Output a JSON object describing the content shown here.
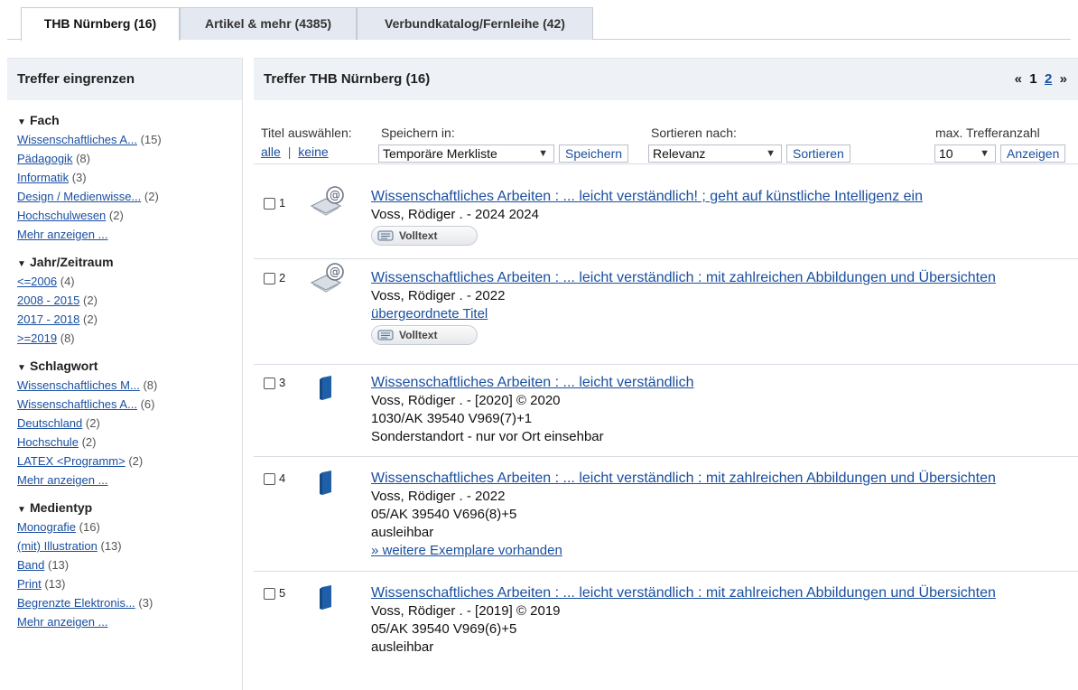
{
  "tabs": [
    {
      "label": "THB Nürnberg (16)",
      "active": true
    },
    {
      "label": "Artikel & mehr (4385)",
      "active": false
    },
    {
      "label": "Verbundkatalog/Fernleihe (42)",
      "active": false
    }
  ],
  "sidebar": {
    "title": "Treffer eingrenzen",
    "facets": [
      {
        "title": "Fach",
        "items": [
          {
            "label": "Wissenschaftliches A...",
            "count": "(15)"
          },
          {
            "label": "Pädagogik",
            "count": "(8)"
          },
          {
            "label": "Informatik",
            "count": "(3)"
          },
          {
            "label": "Design / Medienwisse...",
            "count": "(2)"
          },
          {
            "label": "Hochschulwesen",
            "count": "(2)"
          }
        ],
        "more": "Mehr anzeigen ..."
      },
      {
        "title": "Jahr/Zeitraum",
        "items": [
          {
            "label": "<=2006",
            "count": "(4)"
          },
          {
            "label": "2008 - 2015",
            "count": "(2)"
          },
          {
            "label": "2017 - 2018",
            "count": "(2)"
          },
          {
            "label": ">=2019",
            "count": "(8)"
          }
        ]
      },
      {
        "title": "Schlagwort",
        "items": [
          {
            "label": "Wissenschaftliches M...",
            "count": "(8)"
          },
          {
            "label": "Wissenschaftliches A...",
            "count": "(6)"
          },
          {
            "label": "Deutschland",
            "count": "(2)"
          },
          {
            "label": "Hochschule",
            "count": "(2)"
          },
          {
            "label": "LATEX <Programm>",
            "count": "(2)"
          }
        ],
        "more": "Mehr anzeigen ..."
      },
      {
        "title": "Medientyp",
        "items": [
          {
            "label": "Monografie",
            "count": "(16)"
          },
          {
            "label": "(mit) Illustration",
            "count": "(13)"
          },
          {
            "label": "Band",
            "count": "(13)"
          },
          {
            "label": "Print",
            "count": "(13)"
          },
          {
            "label": "Begrenzte Elektronis...",
            "count": "(3)"
          }
        ],
        "more": "Mehr anzeigen ..."
      }
    ]
  },
  "results_header": {
    "title": "Treffer THB Nürnberg (16)",
    "pager": {
      "prev": "«",
      "page1": "1",
      "page2": "2",
      "next": "»"
    }
  },
  "controls": {
    "select_title_label": "Titel auswählen:",
    "all": "alle",
    "separator": "|",
    "none": "keine",
    "save_in_label": "Speichern in:",
    "save_in_value": "Temporäre Merkliste",
    "save_button": "Speichern",
    "sort_label": "Sortieren nach:",
    "sort_value": "Relevanz",
    "sort_button": "Sortieren",
    "max_label": "max. Trefferanzahl",
    "max_value": "10",
    "show_button": "Anzeigen"
  },
  "results": [
    {
      "num": "1",
      "type": "ebook",
      "title": "Wissenschaftliches Arbeiten : ... leicht verständlich! ; geht auf künstliche Intelligenz ein",
      "author": "Voss, Rödiger . - 2024 2024",
      "lines": [],
      "links": [],
      "volltext": "Volltext"
    },
    {
      "num": "2",
      "type": "ebook",
      "title": "Wissenschaftliches Arbeiten : ... leicht verständlich : mit zahlreichen Abbildungen und Übersichten",
      "author": "Voss, Rödiger . - 2022",
      "lines": [],
      "links": [
        "übergeordnete Titel"
      ],
      "volltext": "Volltext"
    },
    {
      "num": "3",
      "type": "book",
      "title": "Wissenschaftliches Arbeiten : ... leicht verständlich",
      "author": "Voss, Rödiger . - [2020] © 2020",
      "lines": [
        "1030/AK 39540 V969(7)+1",
        "Sonderstandort - nur vor Ort einsehbar"
      ],
      "links": []
    },
    {
      "num": "4",
      "type": "book",
      "title": "Wissenschaftliches Arbeiten : ... leicht verständlich : mit zahlreichen Abbildungen und Übersichten",
      "author": "Voss, Rödiger . - 2022",
      "lines": [
        "05/AK 39540 V696(8)+5",
        "ausleihbar"
      ],
      "links": [
        "» weitere Exemplare vorhanden"
      ]
    },
    {
      "num": "5",
      "type": "book",
      "title": "Wissenschaftliches Arbeiten : ... leicht verständlich : mit zahlreichen Abbildungen und Übersichten",
      "author": "Voss, Rödiger . - [2019] © 2019",
      "lines": [
        "05/AK 39540 V969(6)+5",
        "ausleihbar"
      ],
      "links": []
    }
  ]
}
